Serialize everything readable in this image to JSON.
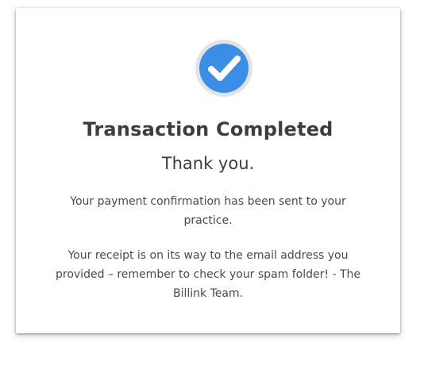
{
  "confirmation": {
    "status_icon": "check-circle-icon",
    "accent_color": "#3b8ee6",
    "title": "Transaction Completed",
    "subtitle": "Thank you.",
    "message_1": "Your payment confirmation has been sent to your practice.",
    "message_2": "Your receipt is on its way to the email address you provided – remember to check your spam folder! - The Billink Team."
  }
}
